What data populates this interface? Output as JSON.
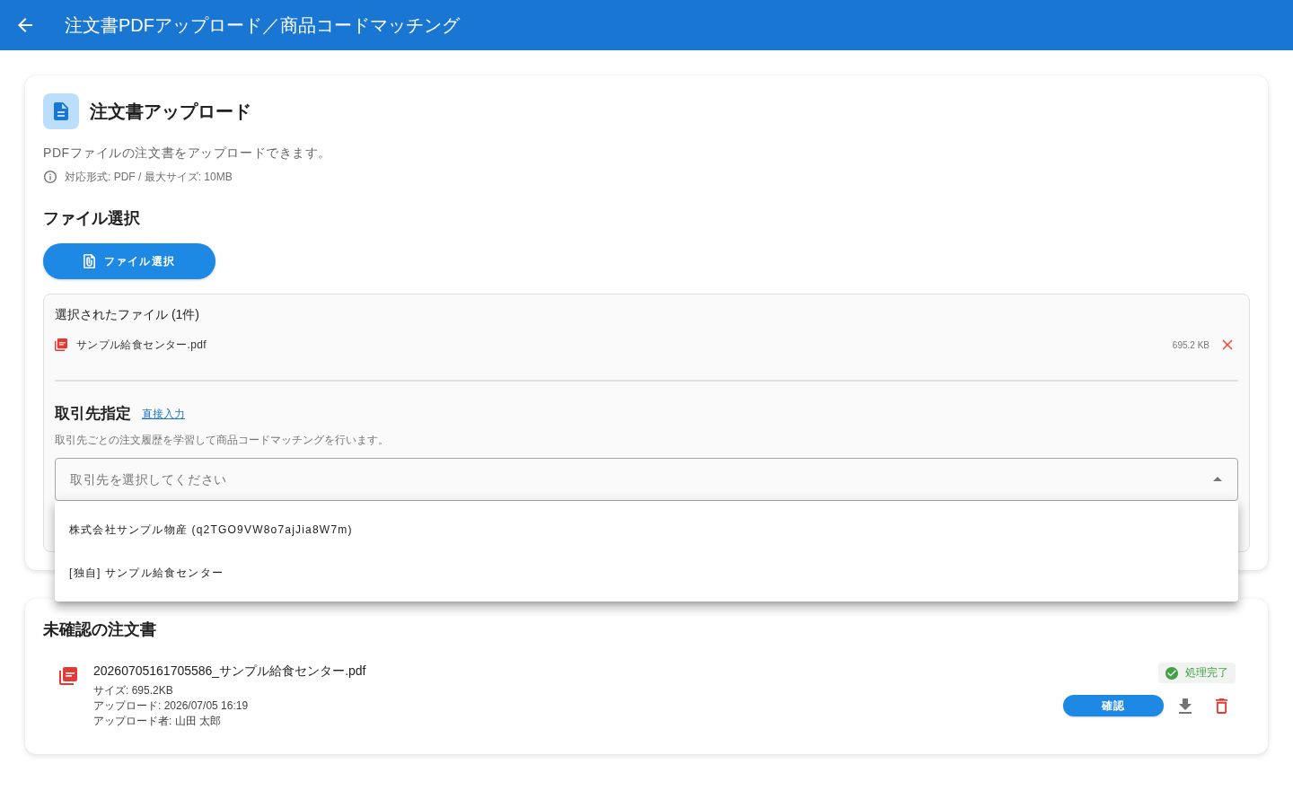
{
  "app_bar": {
    "title": "注文書PDFアップロード／商品コードマッチング"
  },
  "upload_card": {
    "title": "注文書アップロード",
    "description": "PDFファイルの注文書をアップロードできます。",
    "info": "対応形式: PDF / 最大サイズ: 10MB",
    "file_section_title": "ファイル選択",
    "select_button": "ファイル選択",
    "selected_files": {
      "title": "選択されたファイル (1件)",
      "files": [
        {
          "name": "サンプル給食センター.pdf",
          "size": "695.2 KB"
        }
      ]
    },
    "supplier": {
      "title": "取引先指定",
      "link": "直接入力",
      "description": "取引先ごとの注文履歴を学習して商品コードマッチングを行います。",
      "select": {
        "placeholder": "取引先を選択してください",
        "expanded": true,
        "options": [
          {
            "label": "株式会社サンプル物産 (q2TGO9VW8o7ajJia8W7m)",
            "selected": false
          },
          {
            "label": "[独自] サンプル給食センター",
            "selected": false
          }
        ]
      }
    }
  },
  "pending_card": {
    "title": "未確認の注文書",
    "documents": [
      {
        "name": "20260705161705586_サンプル給食センター.pdf",
        "size": "サイズ: 695.2KB",
        "uploaded_at": "アップロード: 2026/07/05 16:19",
        "uploaded_by": "アップロード者: 山田 太郎",
        "status": "処理完了",
        "confirm_button": "確認"
      }
    ]
  }
}
